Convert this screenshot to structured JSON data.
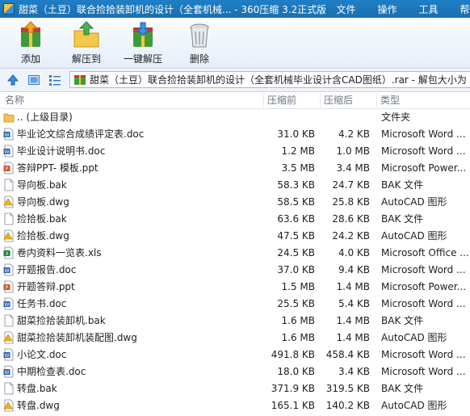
{
  "window": {
    "title": "甜菜（土豆）联合捡拾装卸机的设计（全套机械... - 360压缩 3.2正式版",
    "menu": [
      "文件",
      "操作",
      "工具",
      "帮助"
    ]
  },
  "toolbar": {
    "buttons": [
      {
        "label": "添加",
        "icon": "add-archive-icon"
      },
      {
        "label": "解压到",
        "icon": "extract-to-icon"
      },
      {
        "label": "一键解压",
        "icon": "one-click-extract-icon"
      },
      {
        "label": "删除",
        "icon": "delete-trash-icon"
      }
    ]
  },
  "address": {
    "path": "甜菜（土豆）联合捡拾装卸机的设计（全套机械毕业设计含CAD图纸）.rar - 解包大小为"
  },
  "columns": {
    "name": "名称",
    "packed": "压缩前",
    "unpacked": "压缩后",
    "type": "类型"
  },
  "files": [
    {
      "name": ".. (上级目录)",
      "packed": "",
      "unpacked": "",
      "type": "文件夹",
      "icon": "folder-icon"
    },
    {
      "name": "毕业论文综合成绩评定表.doc",
      "packed": "31.0 KB",
      "unpacked": "4.2 KB",
      "type": "Microsoft Word ...",
      "icon": "word-file-icon"
    },
    {
      "name": "毕业设计说明书.doc",
      "packed": "1.2 MB",
      "unpacked": "1.0 MB",
      "type": "Microsoft Word ...",
      "icon": "word-file-icon"
    },
    {
      "name": "答辩PPT- 模板.ppt",
      "packed": "3.5 MB",
      "unpacked": "3.4 MB",
      "type": "Microsoft Power...",
      "icon": "powerpoint-file-icon"
    },
    {
      "name": "导向板.bak",
      "packed": "58.3 KB",
      "unpacked": "24.7 KB",
      "type": "BAK 文件",
      "icon": "generic-file-icon"
    },
    {
      "name": "导向板.dwg",
      "packed": "58.5 KB",
      "unpacked": "25.8 KB",
      "type": "AutoCAD 图形",
      "icon": "autocad-file-icon"
    },
    {
      "name": "捡拾板.bak",
      "packed": "63.6 KB",
      "unpacked": "28.6 KB",
      "type": "BAK 文件",
      "icon": "generic-file-icon"
    },
    {
      "name": "捡拾板.dwg",
      "packed": "47.5 KB",
      "unpacked": "24.2 KB",
      "type": "AutoCAD 图形",
      "icon": "autocad-file-icon"
    },
    {
      "name": "卷内资料一览表.xls",
      "packed": "24.5 KB",
      "unpacked": "4.0 KB",
      "type": "Microsoft Office ...",
      "icon": "excel-file-icon"
    },
    {
      "name": "开题报告.doc",
      "packed": "37.0 KB",
      "unpacked": "9.4 KB",
      "type": "Microsoft Word ...",
      "icon": "word-file-icon"
    },
    {
      "name": "开题答辩.ppt",
      "packed": "1.5 MB",
      "unpacked": "1.4 MB",
      "type": "Microsoft Power...",
      "icon": "powerpoint-file-icon"
    },
    {
      "name": "任务书.doc",
      "packed": "25.5 KB",
      "unpacked": "5.4 KB",
      "type": "Microsoft Word ...",
      "icon": "word-file-icon"
    },
    {
      "name": "甜菜捡拾装卸机.bak",
      "packed": "1.6 MB",
      "unpacked": "1.4 MB",
      "type": "BAK 文件",
      "icon": "generic-file-icon"
    },
    {
      "name": "甜菜捡拾装卸机装配图.dwg",
      "packed": "1.6 MB",
      "unpacked": "1.4 MB",
      "type": "AutoCAD 图形",
      "icon": "autocad-file-icon"
    },
    {
      "name": "小论文.doc",
      "packed": "491.8 KB",
      "unpacked": "458.4 KB",
      "type": "Microsoft Word ...",
      "icon": "word-file-icon"
    },
    {
      "name": "中期检查表.doc",
      "packed": "18.0 KB",
      "unpacked": "3.4 KB",
      "type": "Microsoft Word ...",
      "icon": "word-file-icon"
    },
    {
      "name": "转盘.bak",
      "packed": "371.9 KB",
      "unpacked": "319.5 KB",
      "type": "BAK 文件",
      "icon": "generic-file-icon"
    },
    {
      "name": "转盘.dwg",
      "packed": "165.1 KB",
      "unpacked": "140.2 KB",
      "type": "AutoCAD 图形",
      "icon": "autocad-file-icon"
    }
  ],
  "colors": {
    "titlebar": "#1f7fc6",
    "toolbar_bg": "#e5eef8",
    "header_text": "#6f7780"
  }
}
